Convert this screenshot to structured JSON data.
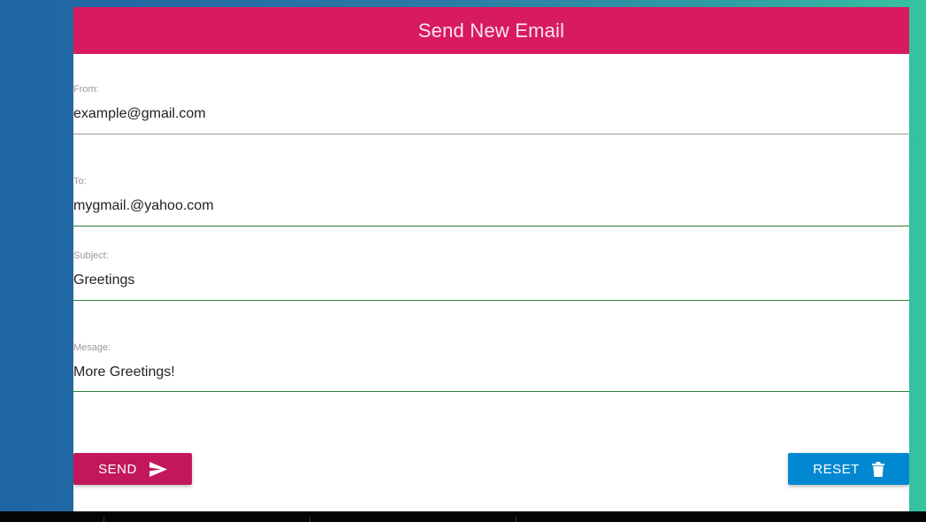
{
  "header": {
    "title": "Send New Email"
  },
  "form": {
    "from": {
      "label": "From:",
      "value": "example@gmail.com"
    },
    "to": {
      "label": "To:",
      "value": "mygmail.@yahoo.com"
    },
    "subject": {
      "label": "Subject:",
      "value": "Greetings"
    },
    "message": {
      "label": "Mesage:",
      "value": "More Greetings!"
    }
  },
  "actions": {
    "send_label": "SEND",
    "send_icon": "send-icon",
    "reset_label": "RESET",
    "reset_icon": "trash-icon"
  },
  "colors": {
    "header": "#d81b60",
    "send_button": "#c2185b",
    "reset_button": "#0288d1",
    "underline_focused": "#2e7d32",
    "underline_default": "#9e9e9e"
  }
}
